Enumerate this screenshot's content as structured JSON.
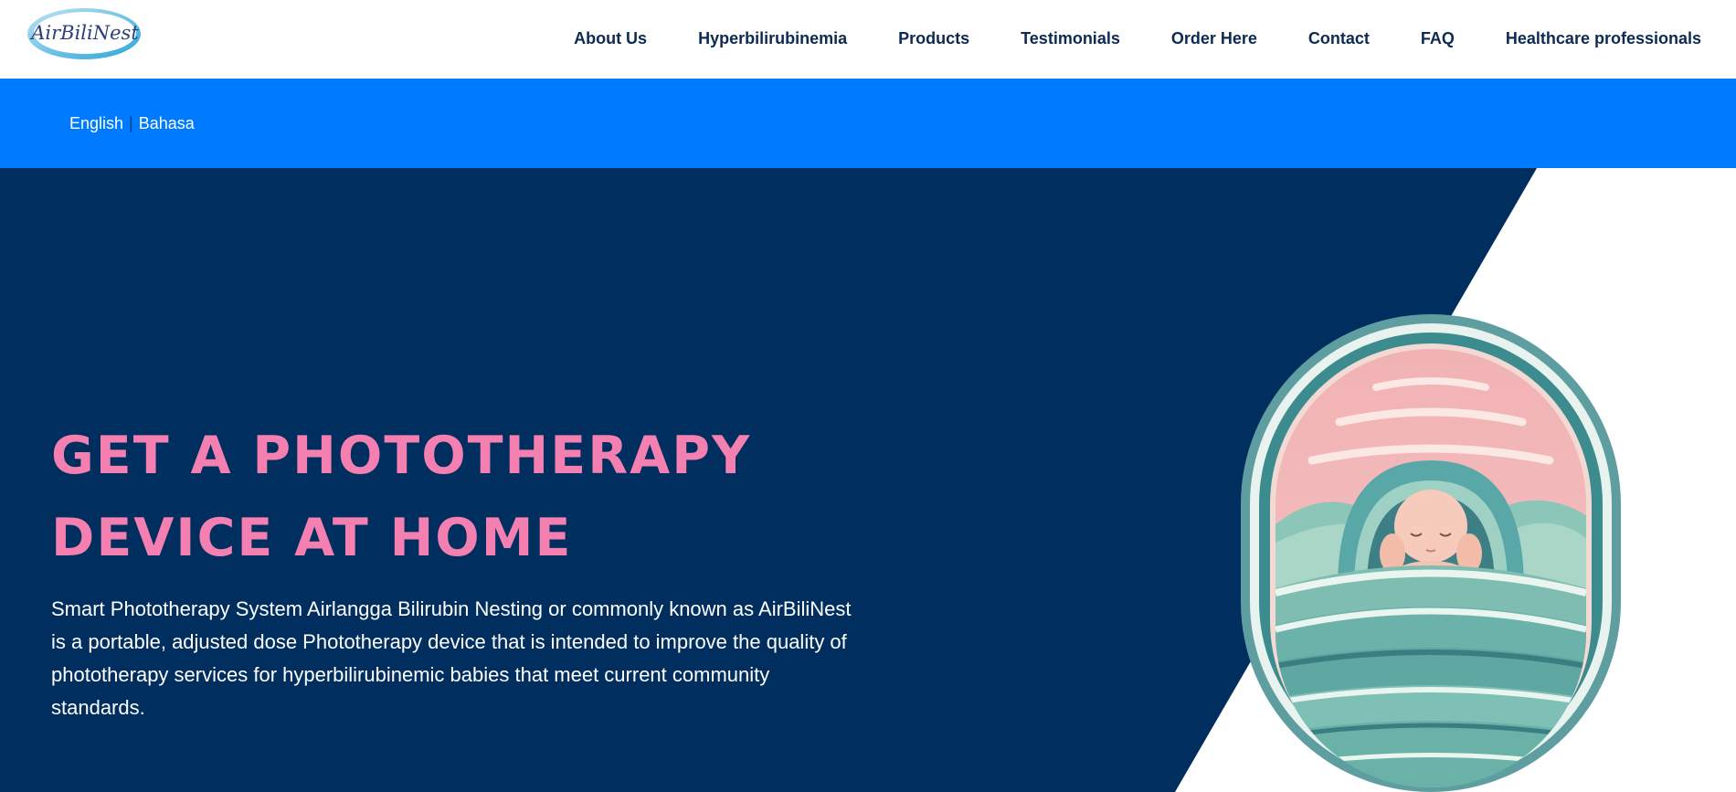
{
  "brand": {
    "logo_text": "AirBiliNest",
    "logo_alt": "AirBiliNest logo"
  },
  "nav": {
    "items": [
      {
        "label": "About Us"
      },
      {
        "label": "Hyperbilirubinemia"
      },
      {
        "label": "Products"
      },
      {
        "label": "Testimonials"
      },
      {
        "label": "Order Here"
      },
      {
        "label": "Contact"
      },
      {
        "label": "FAQ"
      },
      {
        "label": "Healthcare professionals"
      }
    ]
  },
  "language": {
    "english": "English",
    "separator": "|",
    "bahasa": "Bahasa"
  },
  "hero": {
    "headline_line1": "GET A PHOTOTHERAPY",
    "headline_line2": "DEVICE AT HOME",
    "description": "Smart Phototherapy System Airlangga Bilirubin Nesting or commonly known as AirBiliNest is a portable, adjusted dose Phototherapy device that is intended to improve the quality of phototherapy services for hyperbilirubinemic babies that meet current community standards.",
    "illustration": "baby-in-nest-illustration"
  },
  "colors": {
    "nav_text": "#0e2a52",
    "lang_bar": "#007bff",
    "hero_bg": "#002e5f",
    "headline": "#f47fb1"
  }
}
